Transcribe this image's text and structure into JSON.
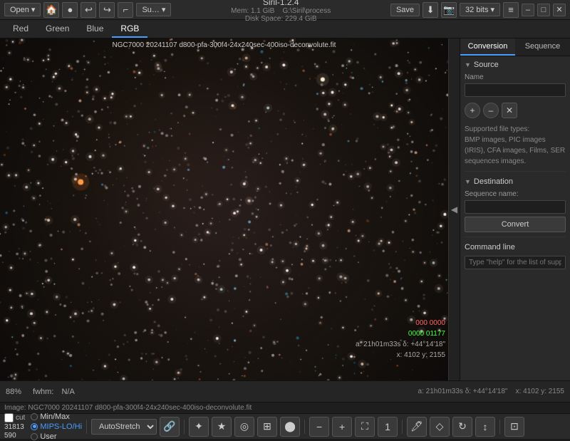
{
  "titlebar": {
    "open_label": "Open",
    "save_label": "Save",
    "app_name": "Siril-1.2.4",
    "mem_label": "Mem: 1.1 GiB",
    "disk_label": "Disk Space: 229.4 GiB",
    "path_label": "G:\\Siril\\process",
    "bits_label": "32 bits",
    "dropdown_arrow": "▾",
    "undo_icon": "↩",
    "redo_icon": "↪",
    "minimize": "–",
    "maximize": "□",
    "close": "✕"
  },
  "channels": {
    "tabs": [
      "Red",
      "Green",
      "Blue",
      "RGB"
    ],
    "active": "RGB"
  },
  "image": {
    "title": "NGC7000 20241107 d800-pfa-300f4-24x240sec-400iso-deconvolute.fit",
    "coord_line1": "a: 21h01m33s δ: +44°14'18\"",
    "coord_line2": "x: 4102  y: 2155"
  },
  "rightpanel": {
    "tabs": [
      "Conversion",
      "Sequence"
    ],
    "active_tab": "Conversion",
    "collapse_icon": "◀",
    "source_section": "Source",
    "source_name_label": "Name",
    "source_name_value": "",
    "add_icon": "+",
    "remove_icon": "–",
    "clear_icon": "✕",
    "supported_label": "Supported file types:",
    "supported_text": "BMP images, PIC images (IRIS), CFA images, Films, SER sequences images.",
    "destination_section": "Destination",
    "sequence_name_label": "Sequence name:",
    "sequence_name_value": "",
    "convert_label": "Convert",
    "cmdline_section": "Command line",
    "cmdline_placeholder": "Type \"help\" for the list of suppo..."
  },
  "statusbar": {
    "zoom": "88%",
    "fwhm_label": "fwhm:",
    "fwhm_value": "N/A"
  },
  "infobar": {
    "text": "Image: NGC7000 20241107 d800-pfa-300f4-24x240sec-400iso-deconvolute.fit"
  },
  "bottombar": {
    "cut_label": "cut",
    "val1": "31813",
    "val2": "590",
    "minmax_label": "Min/Max",
    "mips_label": "MIPS-LO/Hi",
    "user_label": "User",
    "stretch_label": "AutoStretch",
    "link_icon": "🔗",
    "tools": [
      {
        "name": "sunburst-icon",
        "glyph": "✦"
      },
      {
        "name": "star-icon",
        "glyph": "★"
      },
      {
        "name": "target-icon",
        "glyph": "◎"
      },
      {
        "name": "grid-icon",
        "glyph": "⊞"
      },
      {
        "name": "circle-icon",
        "glyph": "⬤"
      },
      {
        "name": "minus-icon",
        "glyph": "−"
      },
      {
        "name": "plus-icon",
        "glyph": "+"
      },
      {
        "name": "fullscreen-icon",
        "glyph": "⛶"
      },
      {
        "name": "one-icon",
        "glyph": "1"
      }
    ],
    "transform_tools": [
      {
        "name": "paint-icon",
        "glyph": "🖊"
      },
      {
        "name": "eraser-icon",
        "glyph": "◇"
      },
      {
        "name": "rotate-icon",
        "glyph": "↻"
      },
      {
        "name": "flip-icon",
        "glyph": "↕"
      }
    ],
    "last_icon": "⊡"
  }
}
